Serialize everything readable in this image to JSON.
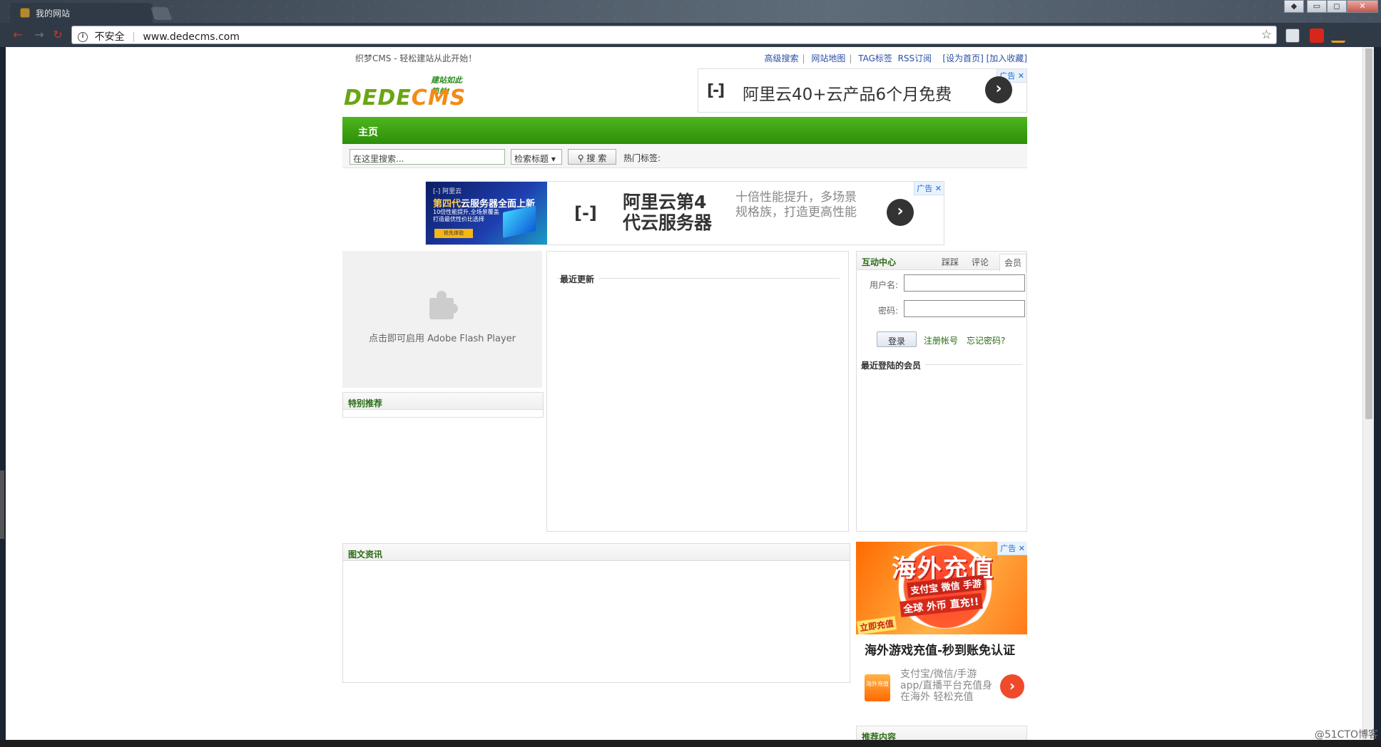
{
  "browser": {
    "tab_title": "我的网站",
    "security_label": "不安全",
    "url": "www.dedecms.com",
    "window_buttons": [
      "▭",
      "◻",
      "✕"
    ]
  },
  "site": {
    "slogan": "织梦CMS - 轻松建站从此开始！",
    "top_links": [
      "高级搜索",
      "网站地图",
      "TAG标签",
      "RSS订阅",
      "[设为首页]",
      "[加入收藏]"
    ],
    "logo": {
      "tagline": "建站如此简单!",
      "text_a": "DEDE",
      "text_b": "CMS"
    },
    "top_ad": {
      "badge": "广告",
      "close": "✕",
      "brand_mark": "[-]",
      "text": "阿里云40+云产品6个月免费",
      "arrow": "›"
    },
    "main_nav": {
      "home": "主页"
    },
    "search": {
      "placeholder": "在这里搜索...",
      "select_value": "检索标题 ▾",
      "button": "搜 索",
      "hot_tags_label": "热门标签:"
    },
    "banner_ad": {
      "badge": "广告",
      "close": "✕",
      "img_brand": "[-] 阿里云",
      "img_title_a": "第四代",
      "img_title_b": "云服务器全面上新",
      "img_sub": "10倍性能提升,全场景覆盖 打造最优性价比选择",
      "img_button": "抢先体验",
      "brand_mark": "[-]",
      "title": "阿里云第4代云服务器",
      "desc": "十倍性能提升，多场景规格族，打造更高性能",
      "arrow": "›"
    },
    "flash": {
      "hint": "点击即可启用 Adobe Flash Player"
    },
    "special": {
      "title": "特别推荐"
    },
    "latest": {
      "title": "最近更新"
    },
    "interaction": {
      "title": "互动中心",
      "tabs": [
        "踩踩",
        "评论",
        "会员"
      ],
      "username_label": "用户名:",
      "password_label": "密码:",
      "login_button": "登录",
      "register_link": "注册帐号",
      "forgot_link": "忘记密码?",
      "recent_members": "最近登陆的会员"
    },
    "photo_news": {
      "title": "图文资讯"
    },
    "side_ad": {
      "badge": "广告",
      "close": "✕",
      "img_title": "海外充值",
      "img_line1": "支付宝 微信 手游",
      "img_line2": "全球 外币 直充!!",
      "img_cta": "立即充值",
      "headline": "海外游戏充值-秒到账免认证",
      "mini_logo": "海外充值",
      "desc": "支付宝/微信/手游app/直播平台充值身在海外 轻松充值",
      "arrow": "›"
    },
    "recommended": {
      "title": "推荐内容"
    }
  },
  "watermark": "@51CTO博客",
  "colors": {
    "nav_green": "#3ea312",
    "link_blue": "#2a4fa8",
    "logo_green": "#6aa514",
    "logo_orange": "#f28b14"
  }
}
